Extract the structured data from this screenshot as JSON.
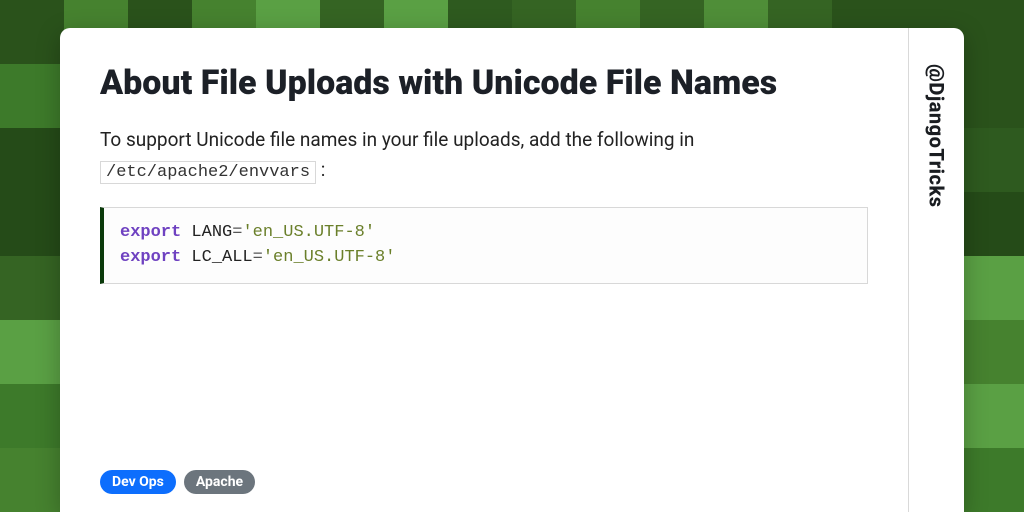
{
  "title": "About File Uploads with Unicode File Names",
  "lead_pre": "To support Unicode file names in your file uploads, add the following in",
  "config_path": "/etc/apache2/envvars",
  "lead_post": ":",
  "code": {
    "lines": [
      {
        "kw": "export",
        "id": "LANG",
        "op": "=",
        "str": "'en_US.UTF-8'"
      },
      {
        "kw": "export",
        "id": "LC_ALL",
        "op": "=",
        "str": "'en_US.UTF-8'"
      }
    ]
  },
  "tags": [
    {
      "label": "Dev Ops",
      "variant": "blue"
    },
    {
      "label": "Apache",
      "variant": "grey"
    }
  ],
  "handle": "@DjangoTricks",
  "bg_palette": [
    "#2e5a1f",
    "#3d7a2a",
    "#4f8e38",
    "#254b18",
    "#5aa044",
    "#356423",
    "#46822f",
    "#2a521b"
  ]
}
